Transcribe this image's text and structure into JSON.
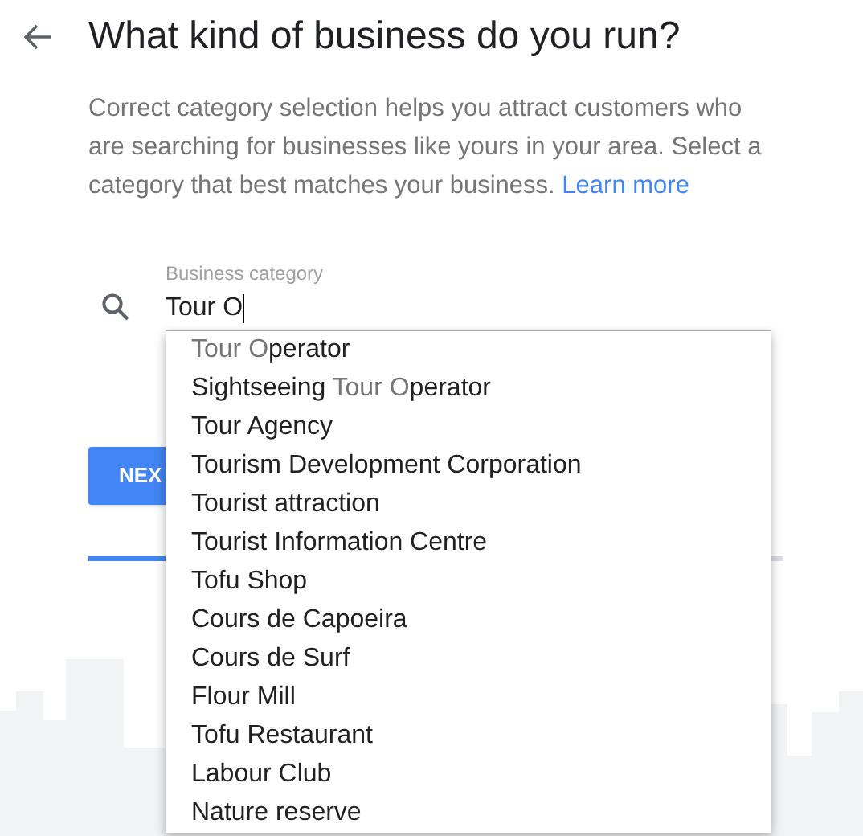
{
  "title": "What kind of business do you run?",
  "description": "Correct category selection helps you attract customers who are searching for businesses like yours in your area. Select a category that best matches your business.",
  "learn_more": "Learn more",
  "field": {
    "label": "Business category",
    "value": "Tour O",
    "focused": true
  },
  "suggestions": [
    {
      "parts": [
        {
          "text": "Tour O",
          "match": true
        },
        {
          "text": "perator",
          "match": false
        }
      ]
    },
    {
      "parts": [
        {
          "text": "Sightseeing ",
          "match": false
        },
        {
          "text": "Tour O",
          "match": true
        },
        {
          "text": "perator",
          "match": false
        }
      ]
    },
    {
      "parts": [
        {
          "text": "Tour Agency",
          "match": false
        }
      ]
    },
    {
      "parts": [
        {
          "text": "Tourism Development Corporation",
          "match": false
        }
      ]
    },
    {
      "parts": [
        {
          "text": "Tourist attraction",
          "match": false
        }
      ]
    },
    {
      "parts": [
        {
          "text": "Tourist Information Centre",
          "match": false
        }
      ]
    },
    {
      "parts": [
        {
          "text": "Tofu Shop",
          "match": false
        }
      ]
    },
    {
      "parts": [
        {
          "text": "Cours de Capoeira",
          "match": false
        }
      ]
    },
    {
      "parts": [
        {
          "text": "Cours de Surf",
          "match": false
        }
      ]
    },
    {
      "parts": [
        {
          "text": "Flour Mill",
          "match": false
        }
      ]
    },
    {
      "parts": [
        {
          "text": "Tofu Restaurant",
          "match": false
        }
      ]
    },
    {
      "parts": [
        {
          "text": "Labour Club",
          "match": false
        }
      ]
    },
    {
      "parts": [
        {
          "text": "Nature reserve",
          "match": false
        }
      ]
    }
  ],
  "next_button": "NEX",
  "progress": {
    "level": 0.2
  }
}
